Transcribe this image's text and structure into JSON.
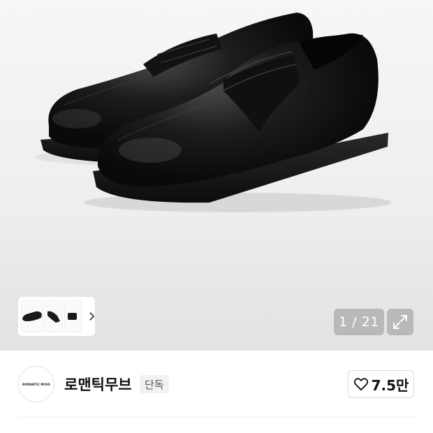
{
  "product_image": {
    "alt": "",
    "icon": "black-penny-loafers-photo"
  },
  "gallery": {
    "thumbnails": [
      "thumbnail-1",
      "thumbnail-2",
      "thumbnail-3"
    ],
    "counter": "1 / 21",
    "expand_icon": "expand-icon",
    "more_icon": "chevron-right-icon"
  },
  "brand": {
    "logo_text": "ROMANTIC MOVE",
    "name": "로맨틱무브",
    "tag": "단독"
  },
  "like": {
    "icon": "heart-outline-icon",
    "count": "7.5만"
  },
  "colors": {
    "overlay": "#969696",
    "text": "#111111",
    "tag_bg": "#f2f2f2"
  }
}
